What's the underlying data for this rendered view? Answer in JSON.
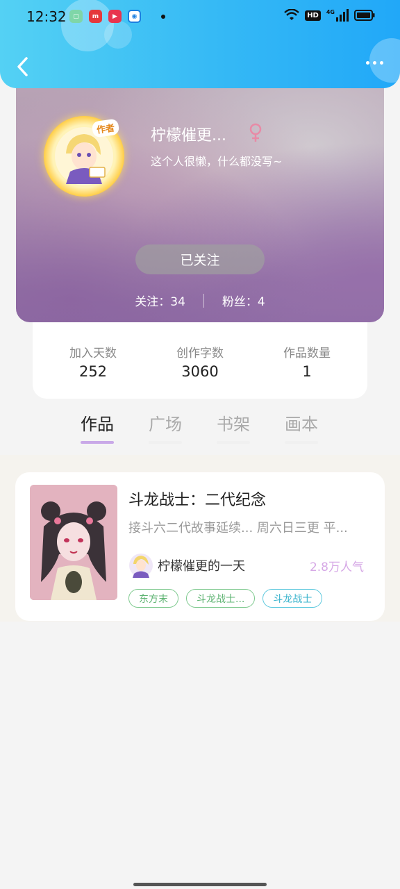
{
  "status_bar": {
    "time": "12:32",
    "network": "4G",
    "hd": "HD"
  },
  "header": {
    "back_icon": "chevron-left-icon",
    "more_icon": "more-dots-icon"
  },
  "profile": {
    "author_badge": "作者",
    "nickname": "柠檬催更...",
    "gender": "female",
    "gender_symbol": "♀",
    "bio": "这个人很懒，什么都没写~",
    "follow_button": "已关注",
    "following": "关注：34",
    "followers": "粉丝：4"
  },
  "stats": [
    {
      "label": "加入天数",
      "value": "252"
    },
    {
      "label": "创作字数",
      "value": "3060"
    },
    {
      "label": "作品数量",
      "value": "1"
    }
  ],
  "tabs": [
    {
      "label": "作品",
      "active": true
    },
    {
      "label": "广场",
      "active": false
    },
    {
      "label": "书架",
      "active": false
    },
    {
      "label": "画本",
      "active": false
    }
  ],
  "works": [
    {
      "title": "斗龙战士：二代纪念",
      "description": "接斗六二代故事延续￼... 周六日三更 平...",
      "author": "柠檬催更的一天",
      "popularity": "2.8万人气",
      "tags": [
        "东方末",
        "斗龙战士...",
        "斗龙战士"
      ]
    }
  ],
  "colors": {
    "header_blue": "#35b9f5",
    "accent_purple": "#c9a9e8",
    "gender_pink": "#e88aa6",
    "tag_green": "#5db371",
    "tag_cyan": "#38b3cc"
  }
}
